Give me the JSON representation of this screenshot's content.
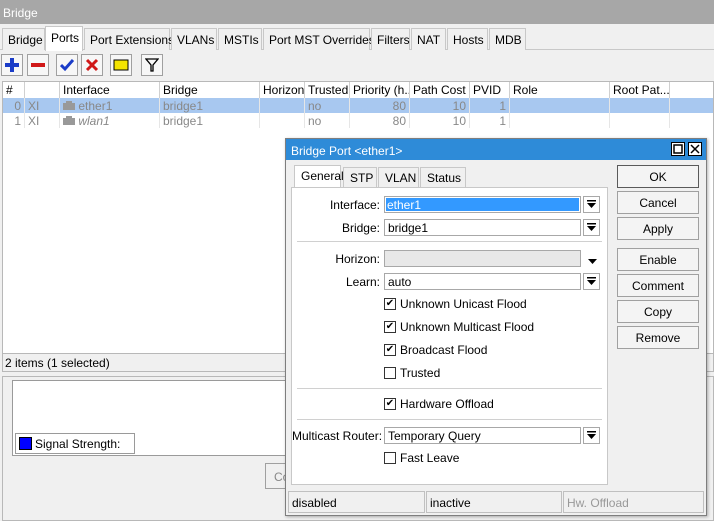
{
  "window": {
    "title": "Bridge"
  },
  "tabs": [
    "Bridge",
    "Ports",
    "Port Extensions",
    "VLANs",
    "MSTIs",
    "Port MST Overrides",
    "Filters",
    "NAT",
    "Hosts",
    "MDB"
  ],
  "active_tab": "Ports",
  "table": {
    "columns": [
      "#",
      "",
      "Interface",
      "Bridge",
      "Horizon",
      "Trusted",
      "Priority (h...",
      "Path Cost",
      "PVID",
      "Role",
      "Root Pat..."
    ],
    "rows": [
      {
        "num": "0",
        "flag": "XI",
        "interface": "ether1",
        "bridge": "bridge1",
        "horizon": "",
        "trusted": "no",
        "priority": "80",
        "path_cost": "10",
        "pvid": "1",
        "role": "",
        "root": ""
      },
      {
        "num": "1",
        "flag": "XI",
        "interface": "wlan1",
        "bridge": "bridge1",
        "horizon": "",
        "trusted": "no",
        "priority": "80",
        "path_cost": "10",
        "pvid": "1",
        "role": "",
        "root": ""
      }
    ]
  },
  "status": {
    "items": "2 items (1 selected)"
  },
  "lower": {
    "legend": "Signal Strength:",
    "button_partial": "Co"
  },
  "colors": {
    "title_bar": "#a7a7a7",
    "dialog_title": "#2e8bd8",
    "selected_row": "#a8c8f0",
    "signal_swatch": "#0000ff"
  },
  "dialog": {
    "title": "Bridge Port <ether1>",
    "tabs": [
      "General",
      "STP",
      "VLAN",
      "Status"
    ],
    "active_tab": "General",
    "fields": {
      "interface": {
        "label": "Interface:",
        "value": "ether1"
      },
      "bridge": {
        "label": "Bridge:",
        "value": "bridge1"
      },
      "horizon": {
        "label": "Horizon:",
        "value": ""
      },
      "learn": {
        "label": "Learn:",
        "value": "auto"
      },
      "multicast_router": {
        "label": "Multicast Router:",
        "value": "Temporary Query"
      }
    },
    "checks": {
      "unknown_unicast": {
        "label": "Unknown Unicast Flood",
        "checked": true
      },
      "unknown_multicast": {
        "label": "Unknown Multicast Flood",
        "checked": true
      },
      "broadcast": {
        "label": "Broadcast Flood",
        "checked": true
      },
      "trusted": {
        "label": "Trusted",
        "checked": false
      },
      "hw_offload": {
        "label": "Hardware Offload",
        "checked": true
      },
      "fast_leave": {
        "label": "Fast Leave",
        "checked": false
      }
    },
    "buttons": {
      "ok": "OK",
      "cancel": "Cancel",
      "apply": "Apply",
      "enable": "Enable",
      "comment": "Comment",
      "copy": "Copy",
      "remove": "Remove"
    },
    "status": {
      "state": "disabled",
      "activity": "inactive",
      "hw": "Hw. Offload"
    }
  }
}
